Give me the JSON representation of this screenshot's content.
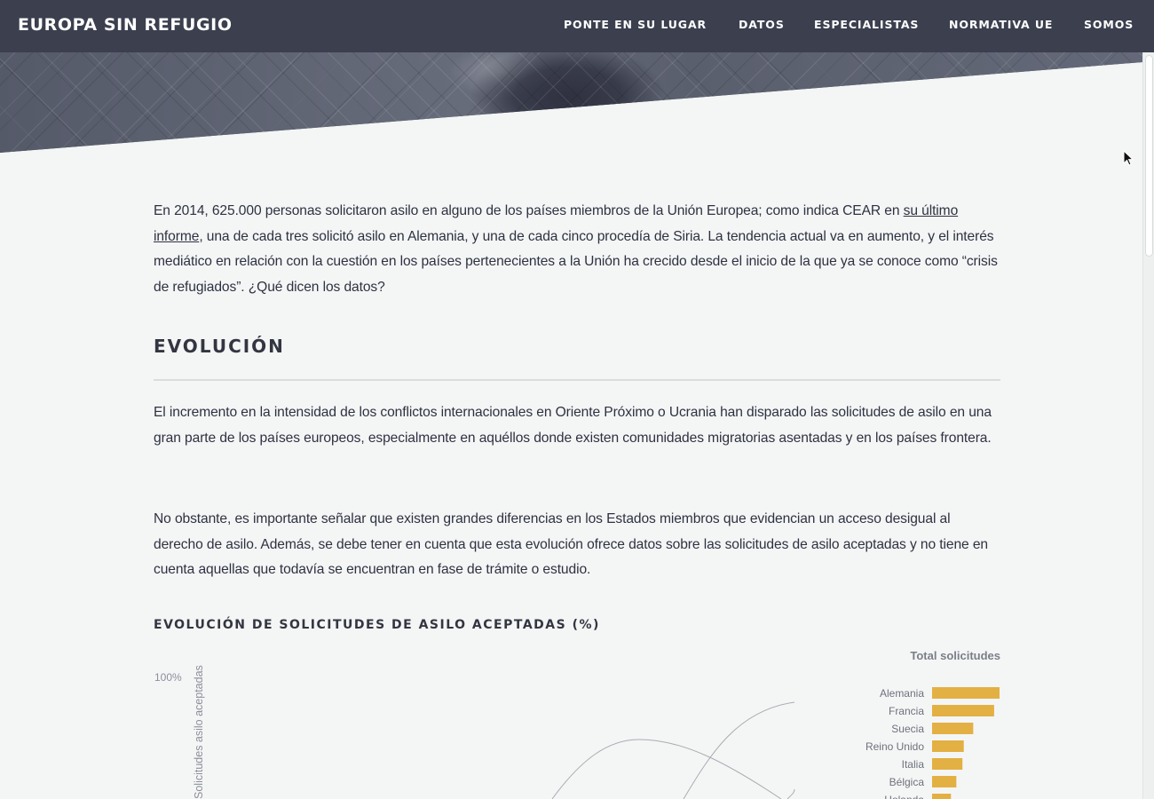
{
  "header": {
    "brand": "EUROPA SIN REFUGIO",
    "nav": [
      {
        "label": "PONTE EN SU LUGAR"
      },
      {
        "label": "DATOS"
      },
      {
        "label": "ESPECIALISTAS"
      },
      {
        "label": "NORMATIVA UE"
      },
      {
        "label": "SOMOS"
      }
    ]
  },
  "intro": {
    "before_link": "En 2014, 625.000 personas solicitaron asilo en alguno de los países miembros de la Unión Europea; como indica CEAR en ",
    "link_text": "su último informe",
    "after_link": ", una de cada tres solicitó asilo en Alemania, y una de cada cinco procedía de Siria. La tendencia actual va en aumento, y el interés mediático en relación con la cuestión en los países pertenecientes a la Unión ha crecido desde el inicio de la que ya se conoce como “crisis de refugiados”. ¿Qué dicen los datos?"
  },
  "section": {
    "title": "EVOLUCIÓN",
    "paragraph1": "El incremento en la intensidad de los conflictos internacionales en Oriente Próximo o Ucrania han disparado las solicitudes de asilo en una gran parte de los países europeos, especialmente en aquéllos donde existen comunidades migratorias asentadas y en los países frontera.",
    "paragraph2": "No obstante, es importante señalar que existen grandes diferencias en los Estados miembros que evidencian un acceso desigual al derecho de asilo. Además, se debe tener en cuenta que esta evolución ofrece datos sobre las solicitudes de asilo aceptadas y no tiene en cuenta aquellas que todavía se encuentran en fase de trámite o estudio."
  },
  "chart_data": {
    "type": "bar",
    "title": "EVOLUCIÓN DE SOLICITUDES DE ASILO ACEPTADAS (%)",
    "ylabel": "Solicitudes asilo aceptadas",
    "ytick_top": "100%",
    "bars_title": "Total solicitudes",
    "bar_color": "#e3b043",
    "line_color": "#a9acb2",
    "categories": [
      "Alemania",
      "Francia",
      "Suecia",
      "Reino Unido",
      "Italia",
      "Bélgica",
      "Holanda"
    ],
    "values": [
      100,
      92,
      61,
      47,
      45,
      36,
      28
    ]
  }
}
